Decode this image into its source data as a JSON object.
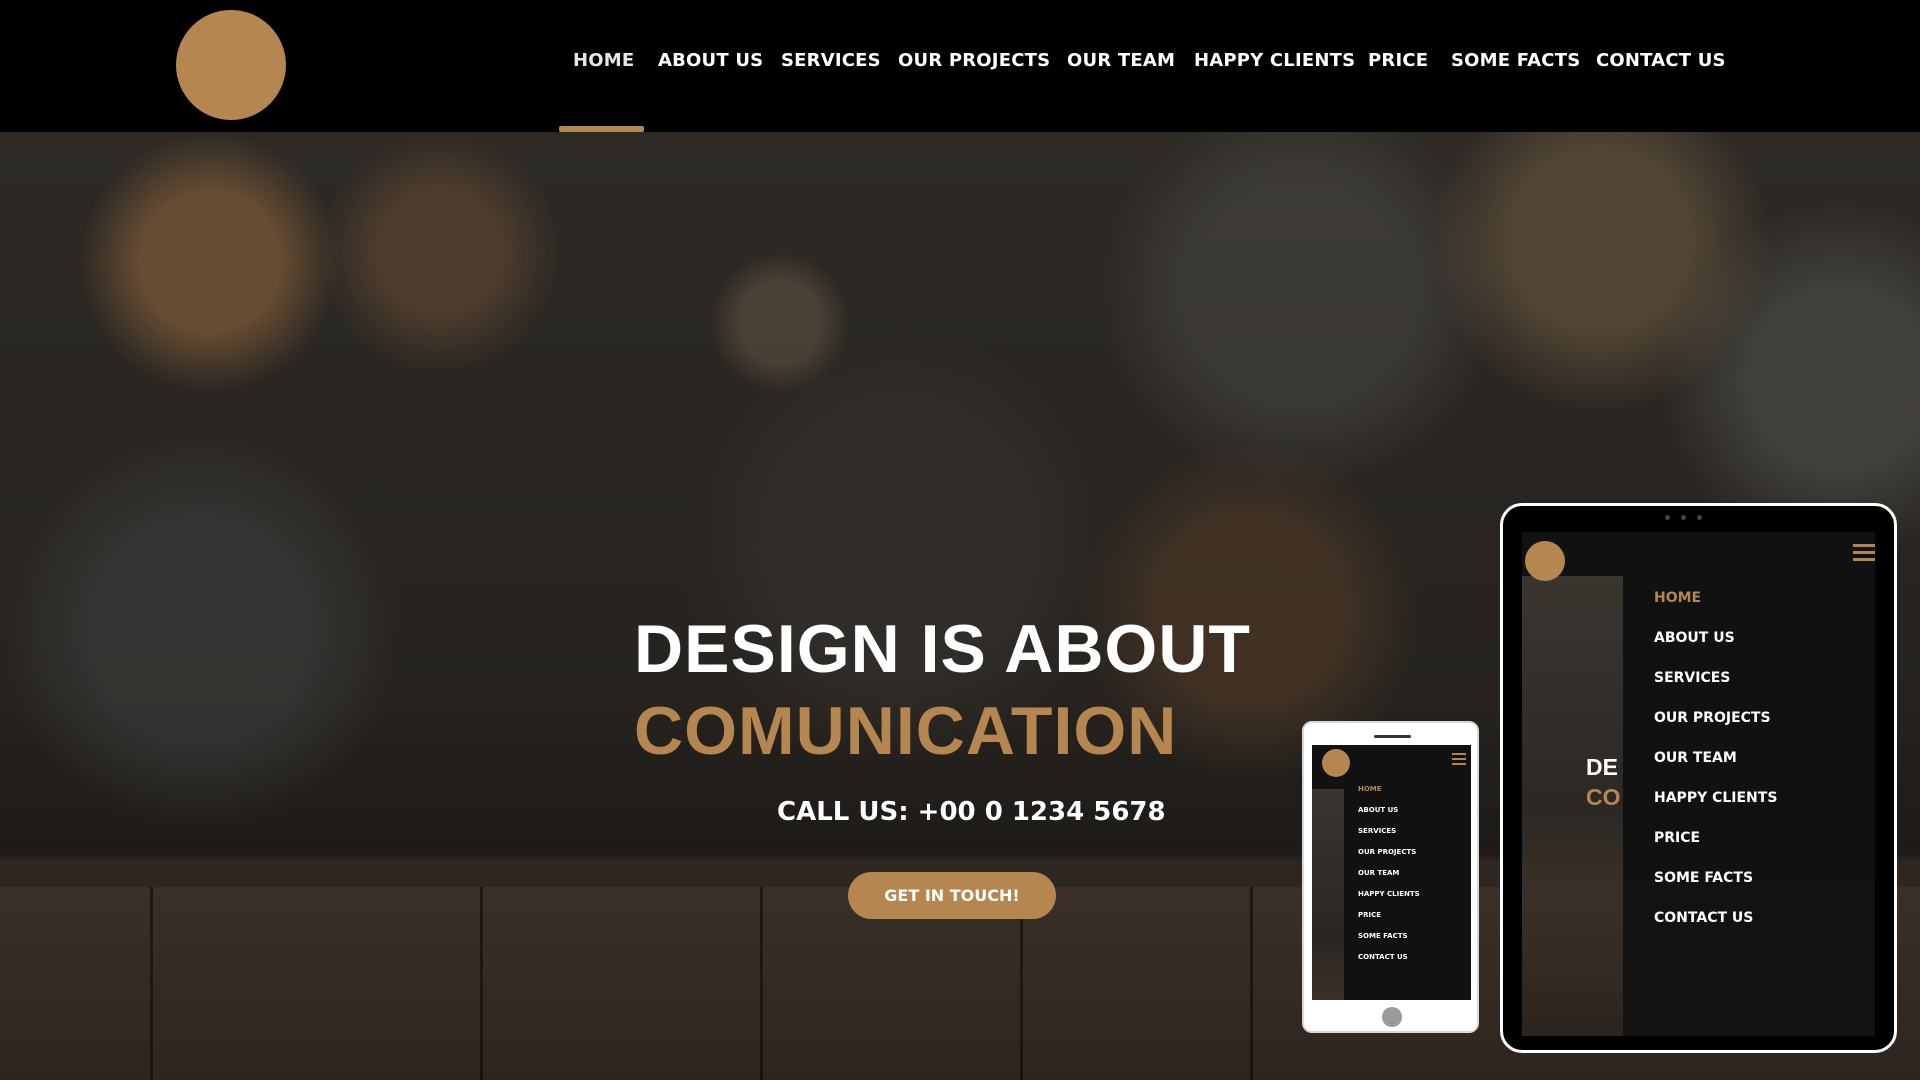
{
  "header": {
    "nav": [
      {
        "label": "HOME",
        "active": true
      },
      {
        "label": "ABOUT US"
      },
      {
        "label": "SERVICES"
      },
      {
        "label": "OUR PROJECTS"
      },
      {
        "label": "OUR TEAM"
      },
      {
        "label": "HAPPY CLIENTS"
      },
      {
        "label": "PRICE"
      },
      {
        "label": "SOME FACTS"
      },
      {
        "label": "CONTACT US"
      }
    ]
  },
  "hero": {
    "headline_line1": "DESIGN IS ABOUT",
    "headline_line2": "COMUNICATION",
    "phone_text": "CALL US: +00 0 1234 5678",
    "cta_label": "GET IN TOUCH!"
  },
  "phone_mockup": {
    "menu": [
      "HOME",
      "ABOUT US",
      "SERVICES",
      "OUR PROJECTS",
      "OUR TEAM",
      "HAPPY CLIENTS",
      "PRICE",
      "SOME FACTS",
      "CONTACT US"
    ]
  },
  "tablet_mockup": {
    "menu": [
      "HOME",
      "ABOUT US",
      "SERVICES",
      "OUR PROJECTS",
      "OUR TEAM",
      "HAPPY CLIENTS",
      "PRICE",
      "SOME FACTS",
      "CONTACT US"
    ],
    "ghost_line1": "DE",
    "ghost_line2": "CO"
  },
  "colors": {
    "accent": "#b58650",
    "background": "#000000",
    "text": "#ffffff"
  },
  "icons": [
    "logo-circle",
    "hamburger-menu-icon"
  ]
}
